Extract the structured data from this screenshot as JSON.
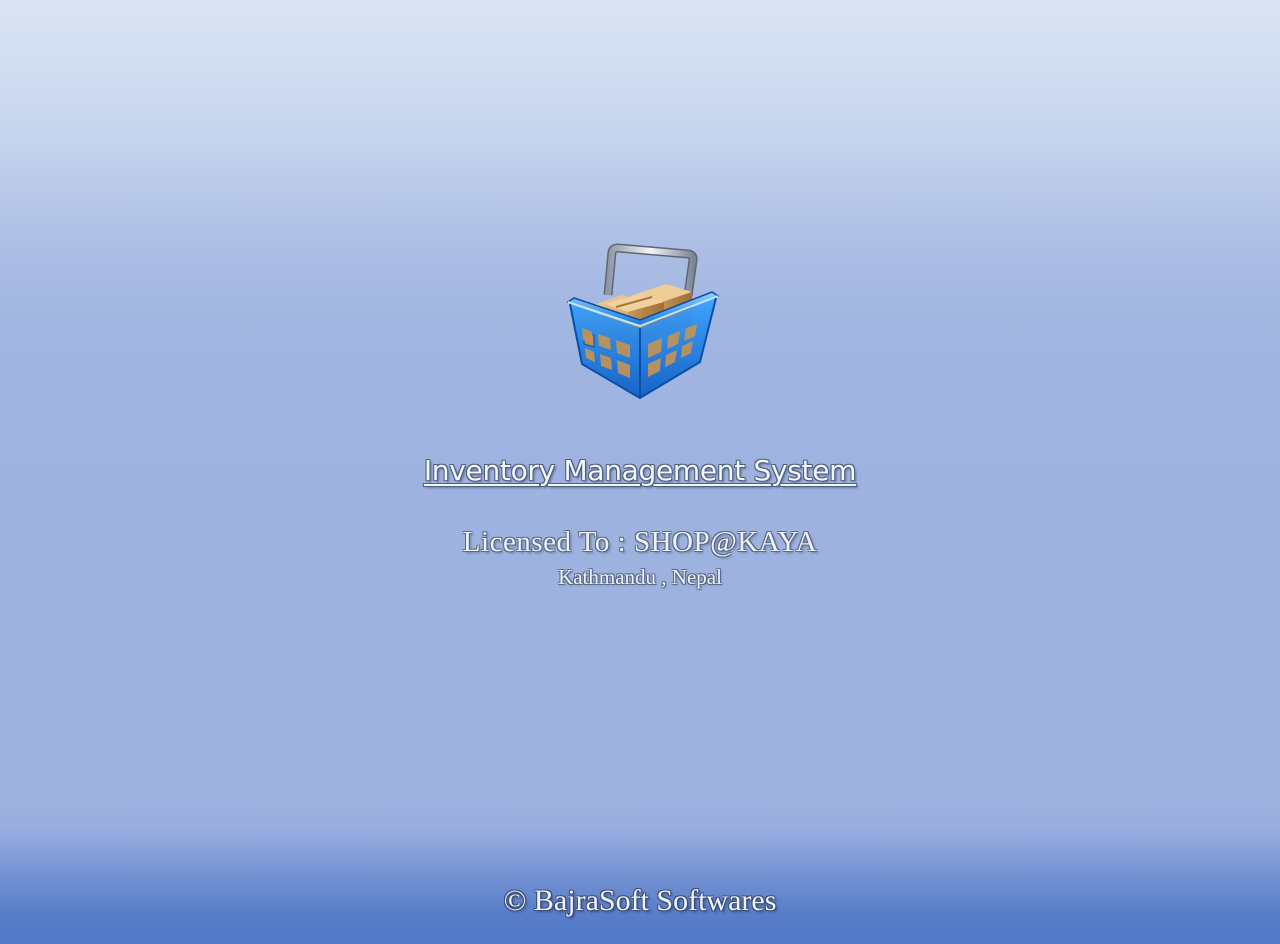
{
  "splash": {
    "icon": "shopping-basket-icon",
    "title": "Inventory Management System",
    "licensed_to": "Licensed To : SHOP@KAYA",
    "location": "Kathmandu , Nepal",
    "copyright": "© BajraSoft Softwares"
  },
  "colors": {
    "background_top": "#d9e3f3",
    "background_mid": "#9db2df",
    "background_bottom": "#5078c6",
    "basket_blue": "#1f7fe0",
    "box_brown": "#c89a5c",
    "text": "#f4f7fd"
  }
}
